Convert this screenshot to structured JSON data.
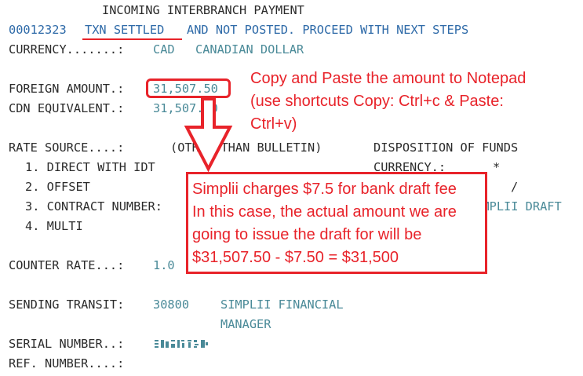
{
  "screen": {
    "title": "INCOMING INTERBRANCH PAYMENT",
    "reference": "00012323",
    "status": "TXN SETTLED",
    "status_rest": "AND NOT POSTED. PROCEED WITH NEXT STEPS",
    "currency_label": "CURRENCY.......:",
    "currency_code": "CAD",
    "currency_name": "CANADIAN DOLLAR",
    "foreign_amount_label": "FOREIGN AMOUNT.:",
    "foreign_amount": "31,507.50",
    "cdn_equivalent_label": "CDN EQUIVALENT.:",
    "cdn_equivalent": "31,507.50",
    "rate_source_label": "RATE SOURCE....:",
    "rate_source_value": "(OTHER THAN BULLETIN)",
    "rate_options": [
      "1. DIRECT WITH IDT",
      "2. OFFSET",
      "3. CONTRACT NUMBER:",
      "4. MULTI"
    ],
    "disposition_label": "DISPOSITION OF FUNDS",
    "disp_currency_label": "CURRENCY.:",
    "disp_currency_value": "*",
    "disp_slash": "/",
    "disp_payee": "SIMPLII DRAFT",
    "counter_rate_label": "COUNTER RATE...:",
    "counter_rate": "1.0",
    "sending_transit_label": "SENDING TRANSIT:",
    "sending_transit": "30800",
    "sending_name_1": "SIMPLII FINANCIAL",
    "sending_name_2": "MANAGER",
    "serial_number_label": "SERIAL NUMBER..:",
    "ref_number_label": "REF. NUMBER....:"
  },
  "annotations": {
    "copy_note": [
      "Copy and Paste the amount to Notepad",
      "(use shortcuts Copy: Ctrl+c & Paste:",
      "Ctrl+v)"
    ],
    "fee_note": [
      "Simplii charges $7.5 for bank draft fee",
      "In this case, the actual amount we are",
      "going to issue the draft for will be",
      "$31,507.50 - $7.50 = $31,500"
    ]
  },
  "colors": {
    "annotation": "#e8232a",
    "field_value": "#4a8a98",
    "status_text": "#2e6aa8",
    "label_text": "#2b2b2b"
  }
}
